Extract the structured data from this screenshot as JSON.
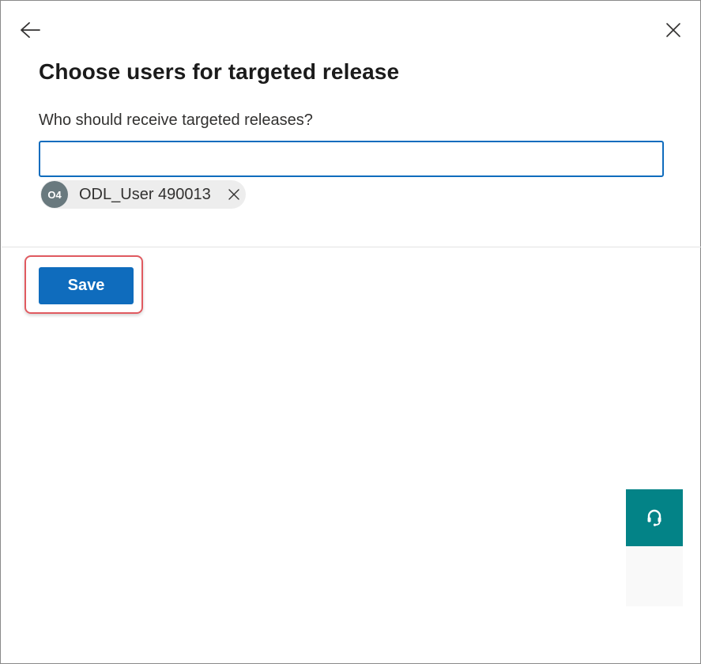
{
  "panel": {
    "title": "Choose users for targeted release",
    "back_icon": "arrow-left-icon",
    "close_icon": "close-icon"
  },
  "recipients": {
    "label": "Who should receive targeted releases?",
    "input_value": "",
    "input_placeholder": "",
    "selected_users": [
      {
        "initials": "O4",
        "name": "ODL_User 490013",
        "remove_icon": "close-icon"
      }
    ]
  },
  "footer": {
    "save_label": "Save"
  },
  "help": {
    "icon": "headset-icon"
  },
  "colors": {
    "primary": "#0f6cbd",
    "avatar": "#69797e",
    "chip_bg": "#ededed",
    "help_teal": "#038387",
    "highlight_border": "#e05a60"
  }
}
